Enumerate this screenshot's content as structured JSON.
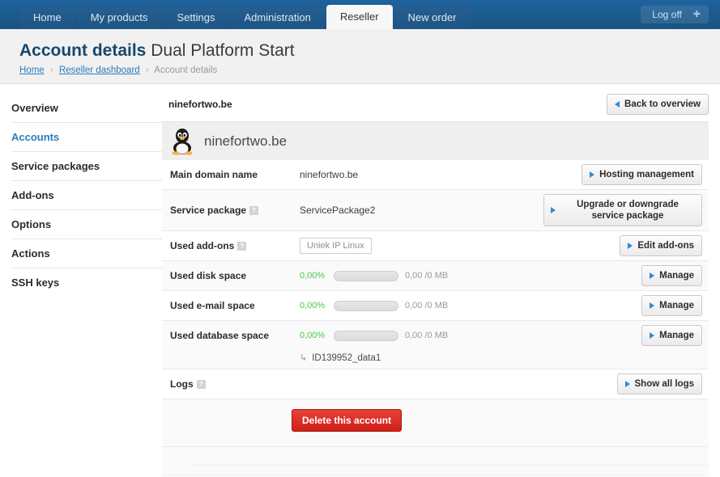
{
  "topnav": {
    "tabs": [
      {
        "label": "Home",
        "active": false
      },
      {
        "label": "My products",
        "active": false
      },
      {
        "label": "Settings",
        "active": false
      },
      {
        "label": "Administration",
        "active": false
      },
      {
        "label": "Reseller",
        "active": true
      },
      {
        "label": "New order",
        "active": false
      }
    ],
    "logoff_label": "Log off",
    "logoff_icon": "plus-icon",
    "bar_color": "#1b5e9e",
    "active_tab_bg": "#f7f7f7"
  },
  "header": {
    "title_strong": "Account details",
    "title_light": "Dual Platform Start",
    "breadcrumb": [
      {
        "label": "Home",
        "link": true
      },
      {
        "label": "Reseller dashboard",
        "link": true
      },
      {
        "label": "Account details",
        "link": false
      }
    ],
    "separator": "❯",
    "link_color": "#2e7cb8"
  },
  "sidebar": {
    "items": [
      {
        "label": "Overview",
        "active": false
      },
      {
        "label": "Accounts",
        "active": true
      },
      {
        "label": "Service packages",
        "active": false
      },
      {
        "label": "Add-ons",
        "active": false
      },
      {
        "label": "Options",
        "active": false
      },
      {
        "label": "Actions",
        "active": false
      },
      {
        "label": "SSH keys",
        "active": false
      }
    ]
  },
  "main": {
    "account_name": "ninefortwo.be",
    "back_button": "Back to overview",
    "tux_icon": "linux-penguin-icon",
    "tux_domain": "ninefortwo.be",
    "rows": [
      {
        "label": "Main domain name",
        "help": false,
        "value": "ninefortwo.be",
        "action": "Hosting management"
      },
      {
        "label": "Service package",
        "help": true,
        "value": "ServicePackage2",
        "action": "Upgrade or downgrade service package"
      },
      {
        "label": "Used add-ons",
        "help": true,
        "tag": "Uniek IP Linux",
        "action": "Edit add-ons"
      },
      {
        "label": "Used disk space",
        "help": false,
        "percent": "0,00%",
        "percent_value": 0,
        "amount": "0,00 /0 MB",
        "action": "Manage"
      },
      {
        "label": "Used e-mail space",
        "help": false,
        "percent": "0,00%",
        "percent_value": 0,
        "amount": "0,00 /0 MB",
        "action": "Manage"
      },
      {
        "label": "Used database space",
        "help": false,
        "percent": "0,00%",
        "percent_value": 0,
        "amount": "0,00 /0 MB",
        "action": "Manage",
        "sub_item": "ID139952_data1"
      },
      {
        "label": "Logs",
        "help": true,
        "action": "Show all logs"
      }
    ],
    "delete_button": "Delete this account",
    "help_glyph": "?",
    "sub_arrow": "↳",
    "progress_color": "#46c94a",
    "danger_color": "#d42019"
  }
}
